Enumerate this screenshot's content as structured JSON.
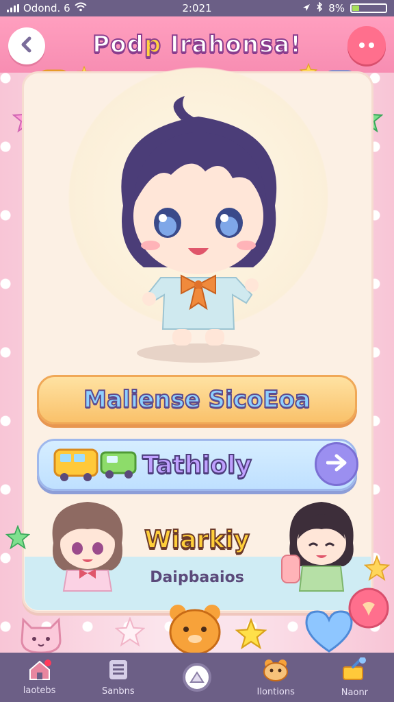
{
  "status_bar": {
    "carrier": "Odond. 6",
    "time": "2:021",
    "battery": "8%"
  },
  "header": {
    "title_part1": "Pod",
    "title_accent": "p",
    "title_part2": " Irahonsa!",
    "back_icon": "chevron-left-icon",
    "menu_icon": "more-dots-icon"
  },
  "main": {
    "primary_button_label": "Maliense SicoEoa",
    "secondary_button_label": "Tathioly",
    "section_title": "Wiarkiy",
    "section_caption": "Daipbaaios"
  },
  "nav": {
    "items": [
      {
        "label": "laotebs",
        "icon": "house-icon"
      },
      {
        "label": "Sanbns",
        "icon": "list-icon"
      },
      {
        "label": "",
        "icon": "camera-shutter-icon"
      },
      {
        "label": "Ilontions",
        "icon": "pet-face-icon"
      },
      {
        "label": "Naonr",
        "icon": "trophy-icon"
      }
    ]
  },
  "colors": {
    "header": "#f78db2",
    "nav": "#6c5f86",
    "panel": "#fcf0e4",
    "primary_button": "#f9c16a",
    "secondary_button": "#bfe0ff"
  }
}
